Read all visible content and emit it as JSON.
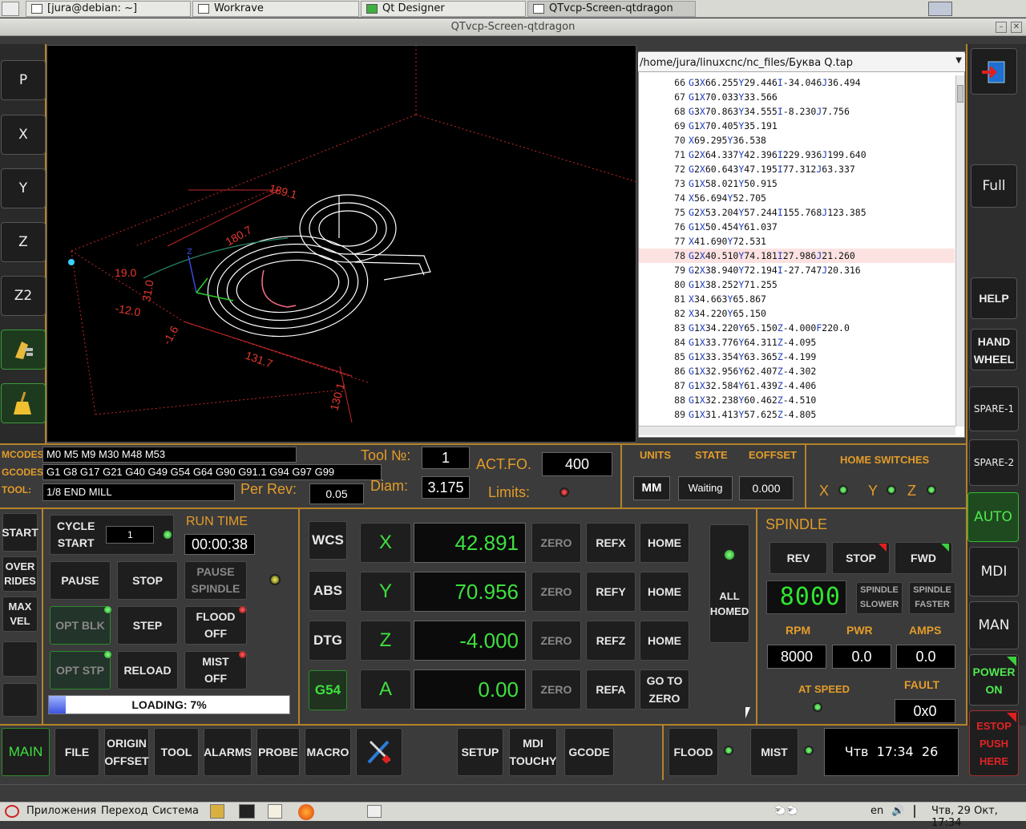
{
  "taskbar_top": {
    "tasks": [
      "[jura@debian: ~]",
      "Workrave",
      "Qt Designer",
      "QTvcp-Screen-qtdragon"
    ]
  },
  "window_title": "QTvcp-Screen-qtdragon",
  "left_buttons": [
    "P",
    "X",
    "Y",
    "Z",
    "Z2"
  ],
  "left_icons": [
    "touch-probe-icon",
    "broom-icon"
  ],
  "viewport": {
    "labels": [
      "189.1",
      "180.7",
      "19.0",
      "31.0",
      "-12.0",
      "-1.6",
      "131.7",
      "130.1"
    ]
  },
  "file": {
    "path": "/home/jura/linuxcnc/nc_files/Буква Q.tap",
    "highlight_line": 78,
    "lines": [
      [
        66,
        "G3X66.255Y29.446I-34.046J36.494"
      ],
      [
        67,
        "G1X70.033Y33.566"
      ],
      [
        68,
        "G3X70.863Y34.555I-8.230J7.756"
      ],
      [
        69,
        "G1X70.405Y35.191"
      ],
      [
        70,
        "X69.295Y36.538"
      ],
      [
        71,
        "G2X64.337Y42.396I229.936J199.640"
      ],
      [
        72,
        "G2X60.643Y47.195I77.312J63.337"
      ],
      [
        73,
        "G1X58.021Y50.915"
      ],
      [
        74,
        "X56.694Y52.705"
      ],
      [
        75,
        "G2X53.204Y57.244I155.768J123.385"
      ],
      [
        76,
        "G1X50.454Y61.037"
      ],
      [
        77,
        "X41.690Y72.531"
      ],
      [
        78,
        "G2X40.510Y74.181I27.986J21.260"
      ],
      [
        79,
        "G2X38.940Y72.194I-27.747J20.316"
      ],
      [
        80,
        "G1X38.252Y71.255"
      ],
      [
        81,
        "X34.663Y65.867"
      ],
      [
        82,
        "X34.220Y65.150"
      ],
      [
        83,
        "G1X34.220Y65.150Z-4.000F220.0"
      ],
      [
        84,
        "G1X33.776Y64.311Z-4.095"
      ],
      [
        85,
        "G1X33.354Y63.365Z-4.199"
      ],
      [
        86,
        "G1X32.956Y62.407Z-4.302"
      ],
      [
        87,
        "G1X32.584Y61.439Z-4.406"
      ],
      [
        88,
        "G1X32.238Y60.462Z-4.510"
      ],
      [
        89,
        "G1X31.413Y57.625Z-4.805"
      ]
    ]
  },
  "right_buttons": {
    "exit_icon": "exit-icon",
    "full": "Full",
    "help": "HELP",
    "hand_wheel": [
      "HAND",
      "WHEEL"
    ],
    "spare1": "SPARE-1",
    "spare2": "SPARE-2",
    "auto": "AUTO",
    "mdi": "MDI",
    "man": "MAN",
    "power_on": [
      "POWER",
      "ON"
    ],
    "estop": [
      "ESTOP",
      "PUSH",
      "HERE"
    ]
  },
  "status": {
    "mcodes_label": "MCODES:",
    "mcodes": "M0 M5 M9 M30 M48 M53",
    "gcodes_label": "GCODES:",
    "gcodes": "G1 G8 G17 G21 G40 G49 G54 G64 G90 G91.1 G94 G97 G99",
    "tool_label": "TOOL:",
    "tool_desc": "1/8 END MILL",
    "tool_no_label": "Tool №:",
    "tool_no": "1",
    "diam_label": "Diam:",
    "diam": "3.175",
    "per_rev_label": "Per Rev:",
    "per_rev": "0.05",
    "act_fo_label": "ACT.FO.",
    "act_fo": "400",
    "limits_label": "Limits:",
    "units_label": "UNITS",
    "units": "MM",
    "state_label": "STATE",
    "state": "Waiting",
    "eoffset_label": "EOFFSET",
    "eoffset": "0.000",
    "home_switches_label": "HOME SWITCHES",
    "home_axes": [
      "X",
      "Y",
      "Z"
    ]
  },
  "program": {
    "start": "START",
    "overrides": [
      "OVER",
      "RIDES"
    ],
    "max_vel": [
      "MAX",
      "VEL"
    ],
    "cycle_start": [
      "CYCLE",
      "START"
    ],
    "cycle_count": "1",
    "run_time_label": "RUN TIME",
    "run_time": "00:00:38",
    "pause": "PAUSE",
    "stop": "STOP",
    "pause_spindle": [
      "PAUSE",
      "SPINDLE"
    ],
    "opt_blk": "OPT BLK",
    "step": "STEP",
    "flood_off": [
      "FLOOD",
      "OFF"
    ],
    "opt_stp": "OPT STP",
    "reload": "RELOAD",
    "mist_off": [
      "MIST",
      "OFF"
    ],
    "loading": "LOADING: 7%",
    "loading_progress": 7
  },
  "dro": {
    "wcs": "WCS",
    "abs": "ABS",
    "dtg": "DTG",
    "g54": "G54",
    "axes": [
      {
        "axis": "X",
        "value": "42.891",
        "zero": "ZERO",
        "ref": "REFX",
        "home": "HOME"
      },
      {
        "axis": "Y",
        "value": "70.956",
        "zero": "ZERO",
        "ref": "REFY",
        "home": "HOME"
      },
      {
        "axis": "Z",
        "value": "-4.000",
        "zero": "ZERO",
        "ref": "REFZ",
        "home": "HOME"
      },
      {
        "axis": "A",
        "value": "0.00",
        "zero": "ZERO",
        "ref": "REFA",
        "home": "GO TO\nZERO"
      }
    ],
    "all_homed": [
      "ALL",
      "HOMED"
    ]
  },
  "spindle": {
    "title": "SPINDLE",
    "rev": "REV",
    "stop": "STOP",
    "fwd": "FWD",
    "lcd": "8000",
    "slower": [
      "SPINDLE",
      "SLOWER"
    ],
    "faster": [
      "SPINDLE",
      "FASTER"
    ],
    "rpm_label": "RPM",
    "pwr_label": "PWR",
    "amps_label": "AMPS",
    "rpm": "8000",
    "pwr": "0.0",
    "amps": "0.0",
    "at_speed_label": "AT SPEED",
    "fault_label": "FAULT",
    "fault": "0x0"
  },
  "bottom_tabs": [
    "MAIN",
    "FILE",
    "ORIGIN\nOFFSET",
    "TOOL",
    "ALARMS",
    "PROBE",
    "MACRO"
  ],
  "bottom_right_tabs": [
    "SETUP",
    "MDI\nTOUCHY",
    "GCODE"
  ],
  "coolant": {
    "flood": "FLOOD",
    "mist": "MIST"
  },
  "clock": "Чтв  17:34  26",
  "taskbar_bottom": {
    "menus": [
      "Приложения",
      "Переход",
      "Система"
    ],
    "lang": "en",
    "datetime": "Чтв, 29 Окт, 17:34"
  }
}
